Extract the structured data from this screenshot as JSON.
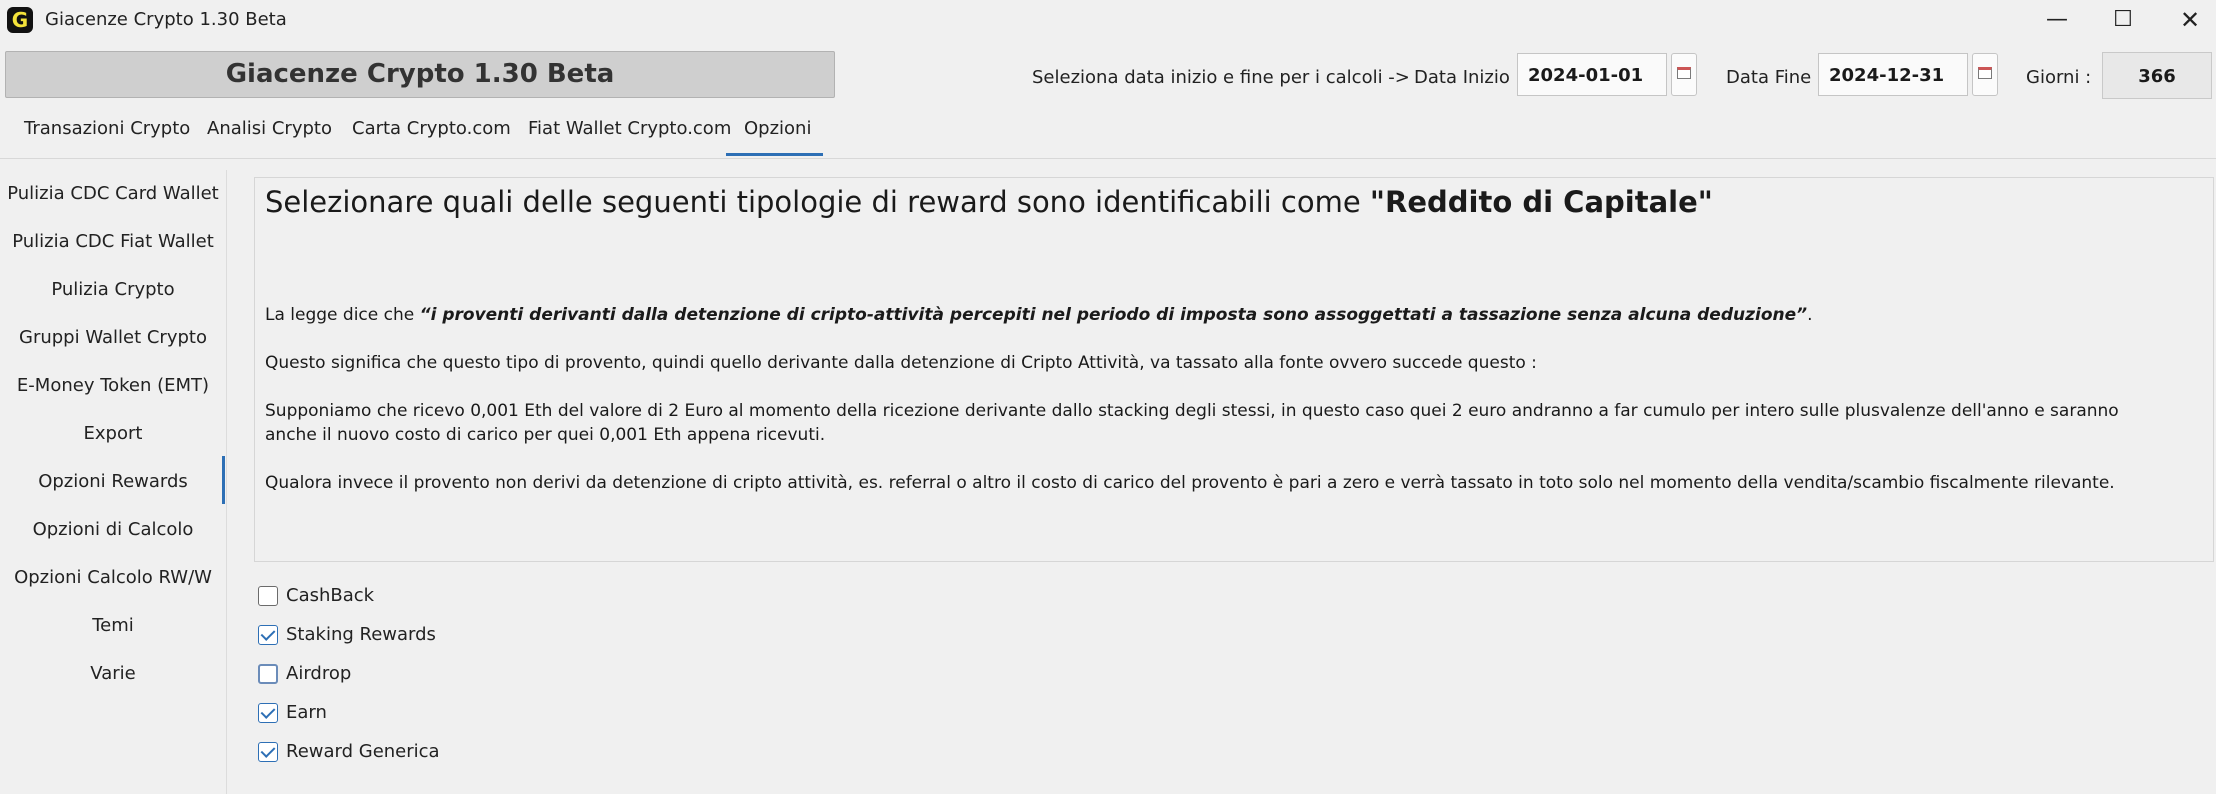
{
  "window": {
    "title": "Giacenze Crypto 1.30 Beta",
    "icon_letter": "G",
    "controls": {
      "minimize": "—",
      "maximize": "☐",
      "close": "✕"
    }
  },
  "header": {
    "app_title": "Giacenze Crypto 1.30 Beta",
    "hint": "Seleziona data inizio e fine per i calcoli ->",
    "start_label": "Data Inizio :",
    "start_value": "2024-01-01",
    "end_label": "Data Fine :",
    "end_value": "2024-12-31",
    "days_label": "Giorni :",
    "days_value": "366"
  },
  "tabs": [
    {
      "label": "Transazioni Crypto",
      "active": false
    },
    {
      "label": "Analisi Crypto",
      "active": false
    },
    {
      "label": "Carta Crypto.com",
      "active": false
    },
    {
      "label": "Fiat Wallet Crypto.com",
      "active": false
    },
    {
      "label": "Opzioni",
      "active": true
    }
  ],
  "sidebar": {
    "items": [
      {
        "label": "Pulizia CDC Card Wallet"
      },
      {
        "label": "Pulizia CDC Fiat Wallet"
      },
      {
        "label": "Pulizia Crypto"
      },
      {
        "label": "Gruppi Wallet Crypto"
      },
      {
        "label": "E-Money Token (EMT)"
      },
      {
        "label": "Export"
      },
      {
        "label": "Opzioni Rewards",
        "active": true
      },
      {
        "label": "Opzioni di Calcolo"
      },
      {
        "label": "Opzioni Calcolo RW/W"
      },
      {
        "label": "Temi"
      },
      {
        "label": "Varie"
      }
    ]
  },
  "panel": {
    "heading_prefix": "Selezionare quali delle seguenti tipologie di reward sono identificabili come ",
    "heading_bold": "\"Reddito di Capitale\"",
    "p1_prefix": "La legge dice che ",
    "p1_quote": "“i proventi derivanti dalla detenzione di cripto-attività percepiti nel periodo di imposta sono assoggettati a tassazione senza alcuna deduzione”",
    "p1_suffix": ".",
    "p2": "Questo significa che questo tipo di provento, quindi quello derivante dalla detenzione di Cripto Attività, va tassato alla fonte ovvero succede questo :",
    "p3": "Supponiamo che ricevo 0,001 Eth del valore di 2 Euro al momento della ricezione derivante dallo stacking degli stessi, in questo caso quei 2 euro andranno a far cumulo per intero sulle plusvalenze dell'anno e saranno anche il nuovo costo di carico per quei 0,001 Eth appena ricevuti.",
    "p4": "Qualora invece il provento non derivi da detenzione di cripto attività, es. referral o altro il costo di carico del provento è pari a zero e verrà tassato in toto solo nel momento della vendita/scambio fiscalmente rilevante."
  },
  "options": [
    {
      "label": "CashBack",
      "checked": false
    },
    {
      "label": "Staking Rewards",
      "checked": true
    },
    {
      "label": "Airdrop",
      "checked": false
    },
    {
      "label": "Earn",
      "checked": true
    },
    {
      "label": "Reward Generica",
      "checked": true
    }
  ]
}
